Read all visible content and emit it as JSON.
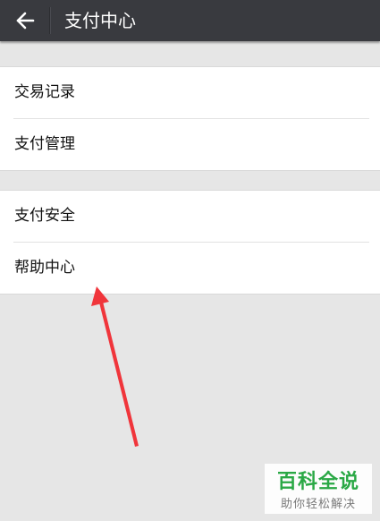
{
  "header": {
    "back_icon": "back-arrow-icon",
    "title": "支付中心"
  },
  "menu": {
    "group1": [
      {
        "label": "交易记录"
      },
      {
        "label": "支付管理"
      }
    ],
    "group2": [
      {
        "label": "支付安全"
      },
      {
        "label": "帮助中心"
      }
    ]
  },
  "annotation": {
    "arrow_color": "#f0353b",
    "points_to": "帮助中心"
  },
  "watermark": {
    "main": "百科全说",
    "sub": "助你轻松解决"
  },
  "colors": {
    "header_bg": "#393a3f",
    "page_bg": "#e6e6e6",
    "watermark_green": "#2aa845"
  }
}
